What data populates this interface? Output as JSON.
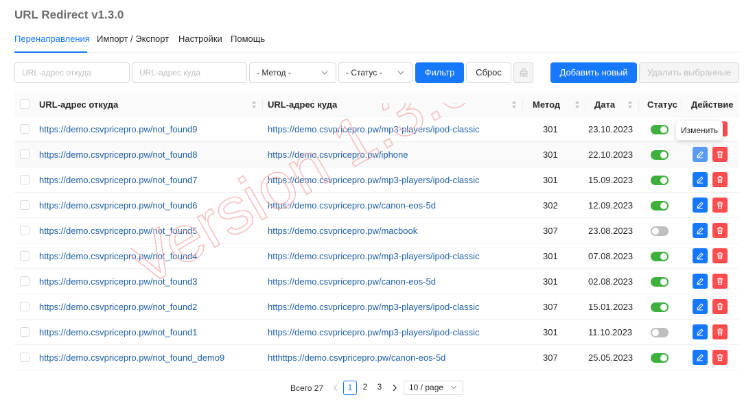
{
  "app": {
    "title": "URL Redirect v1.3.0"
  },
  "tabs": [
    {
      "label": "Перенаправления",
      "active": true
    },
    {
      "label": "Импорт / Экспорт",
      "active": false
    },
    {
      "label": "Настройки",
      "active": false
    },
    {
      "label": "Помощь",
      "active": false
    }
  ],
  "filters": {
    "from_placeholder": "URL-адрес откуда",
    "to_placeholder": "URL-адрес куда",
    "method_select": "- Метод -",
    "status_select": "- Статус -",
    "filter_button": "Фильтр",
    "reset_button": "Сброс",
    "clear_icon": "broom-icon",
    "add_button": "Добавить новый",
    "delete_selected_button": "Удалить выбранные"
  },
  "table": {
    "columns": {
      "from": "URL-адрес откуда",
      "to": "URL-адрес куда",
      "method": "Метод",
      "date": "Дата",
      "status": "Статус",
      "action": "Действие"
    },
    "rows": [
      {
        "from": "https://demo.csvpricepro.pw/not_found9",
        "to": "https://demo.csvpricepro.pw/mp3-players/ipod-classic",
        "method": "301",
        "date": "23.10.2023",
        "status": true
      },
      {
        "from": "https://demo.csvpricepro.pw/not_found8",
        "to": "https://demo.csvpricepro.pw/iphone",
        "method": "301",
        "date": "22.10.2023",
        "status": true
      },
      {
        "from": "https://demo.csvpricepro.pw/not_found7",
        "to": "https://demo.csvpricepro.pw/mp3-players/ipod-classic",
        "method": "301",
        "date": "15.09.2023",
        "status": true
      },
      {
        "from": "https://demo.csvpricepro.pw/not_found6",
        "to": "https://demo.csvpricepro.pw/canon-eos-5d",
        "method": "302",
        "date": "12.09.2023",
        "status": true
      },
      {
        "from": "https://demo.csvpricepro.pw/not_found5",
        "to": "https://demo.csvpricepro.pw/macbook",
        "method": "307",
        "date": "23.08.2023",
        "status": false
      },
      {
        "from": "https://demo.csvpricepro.pw/not_found4",
        "to": "https://demo.csvpricepro.pw/mp3-players/ipod-classic",
        "method": "301",
        "date": "07.08.2023",
        "status": true
      },
      {
        "from": "https://demo.csvpricepro.pw/not_found3",
        "to": "https://demo.csvpricepro.pw/canon-eos-5d",
        "method": "301",
        "date": "02.08.2023",
        "status": true
      },
      {
        "from": "https://demo.csvpricepro.pw/not_found2",
        "to": "https://demo.csvpricepro.pw/mp3-players/ipod-classic",
        "method": "307",
        "date": "15.01.2023",
        "status": true
      },
      {
        "from": "https://demo.csvpricepro.pw/not_found1",
        "to": "https://demo.csvpricepro.pw/mp3-players/ipod-classic",
        "method": "301",
        "date": "11.10.2023",
        "status": false
      },
      {
        "from": "https://demo.csvpricepro.pw/not_found_demo9",
        "to": "htthttps://demo.csvpricepro.pw/canon-eos-5d",
        "method": "307",
        "date": "25.05.2023",
        "status": true
      }
    ]
  },
  "tooltip": {
    "text": "Изменить"
  },
  "watermark": {
    "text": "Version 1.3.0",
    "color": "#f5b5b5"
  },
  "pagination": {
    "total_label": "Всего 27",
    "pages": [
      "1",
      "2",
      "3"
    ],
    "current": "1",
    "page_size": "10 / page"
  },
  "colors": {
    "primary": "#1677ff",
    "danger": "#ff4d4f",
    "toggle_on": "#3fb03f",
    "link": "#1d5fa8"
  }
}
